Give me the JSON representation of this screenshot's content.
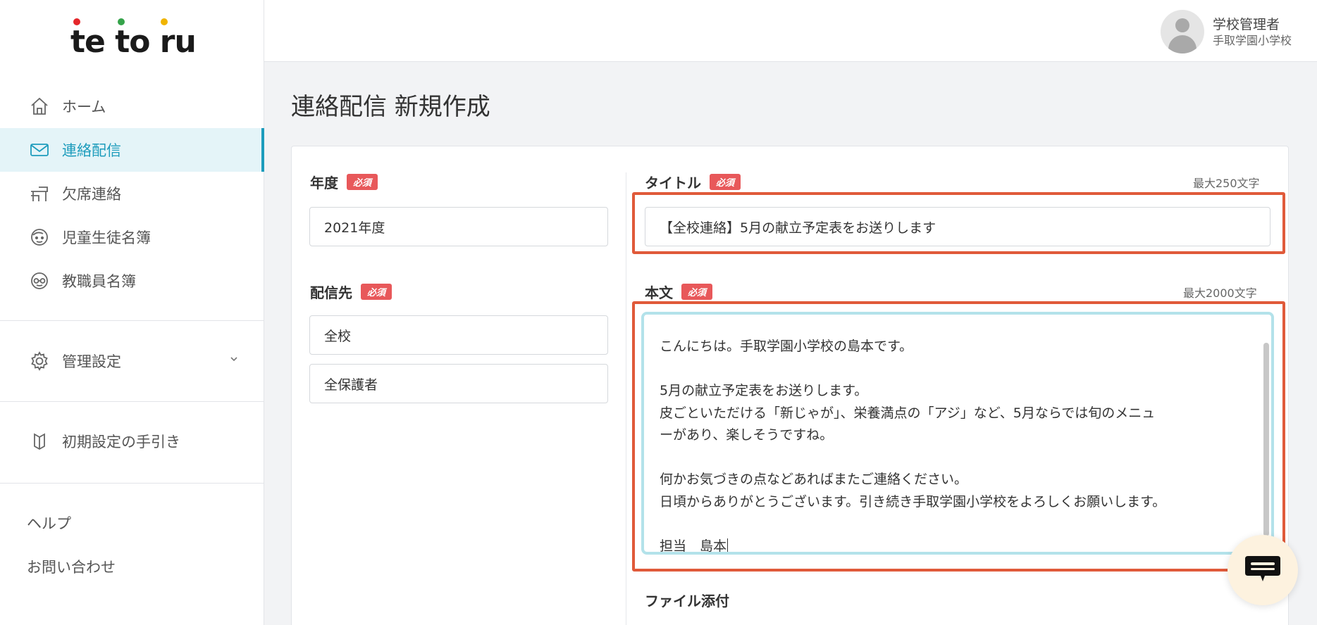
{
  "app": {
    "logo_text": "te to ru",
    "logo_dots": [
      "#e5262a",
      "#35a34a",
      "#f0b400"
    ]
  },
  "sidebar": {
    "items": [
      {
        "label": "ホーム",
        "icon": "home-icon"
      },
      {
        "label": "連絡配信",
        "icon": "mail-icon",
        "active": true
      },
      {
        "label": "欠席連絡",
        "icon": "school-desk-icon"
      },
      {
        "label": "児童生徒名簿",
        "icon": "student-face-icon"
      },
      {
        "label": "教職員名簿",
        "icon": "teacher-face-icon"
      }
    ],
    "settings_label": "管理設定",
    "guide_label": "初期設定の手引き",
    "help_label": "ヘルプ",
    "contact_label": "お問い合わせ"
  },
  "header": {
    "user_name": "学校管理者",
    "school_name": "手取学園小学校"
  },
  "main": {
    "page_title": "連絡配信 新規作成",
    "required_badge": "必須",
    "year": {
      "label": "年度",
      "value": "2021年度"
    },
    "recipients": {
      "label": "配信先",
      "values": [
        "全校",
        "全保護者"
      ]
    },
    "title": {
      "label": "タイトル",
      "max": "最大250文字",
      "value": "【全校連絡】5月の献立予定表をお送りします"
    },
    "body": {
      "label": "本文",
      "max": "最大2000文字",
      "lines": [
        "こんにちは。手取学園小学校の島本です。",
        "",
        "5月の献立予定表をお送りします。",
        "皮ごといただける「新じゃが」、栄養満点の「アジ」など、5月ならでは旬のメニュ",
        "ーがあり、楽しそうですね。",
        "",
        "何かお気づきの点などあればまたご連絡ください。",
        "日頃からありがとうございます。引き続き手取学園小学校をよろしくお願いします。",
        "",
        "担当　島本"
      ]
    },
    "attachment_label": "ファイル添付"
  },
  "colors": {
    "accent": "#1d9cbc",
    "highlight": "#e05a3a",
    "badge": "#e8585a"
  }
}
